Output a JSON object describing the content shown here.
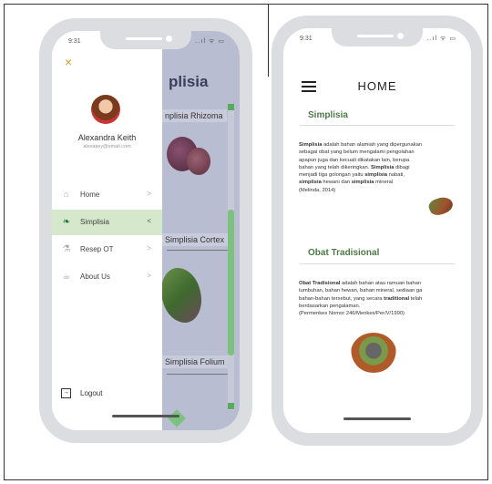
{
  "left_phone": {
    "status_time": "9:31",
    "status_icons": "..ıl ᯤ ▭",
    "background": {
      "title": "plisia",
      "items": [
        "nplisia Rhizoma",
        "Simplisia Cortex",
        "Simplisia Folium"
      ]
    },
    "drawer": {
      "close_glyph": "×",
      "user_name": "Alexandra Keith",
      "user_email": "alexakey@email.com",
      "menu": [
        {
          "icon": "⌂",
          "label": "Home",
          "chevron": ">"
        },
        {
          "icon": "❧",
          "label": "Simplisia",
          "chevron": "<"
        },
        {
          "icon": "⚗",
          "label": "Resep OT",
          "chevron": ">"
        },
        {
          "icon": "☕",
          "label": "About Us",
          "chevron": ">"
        }
      ],
      "logout_label": "Logout",
      "logout_glyph": "→"
    }
  },
  "right_phone": {
    "status_time": "9:31",
    "status_icons": "..ıl ᯤ ▭",
    "title": "HOME",
    "sections": [
      {
        "title": "Simplisia",
        "lines": [
          [
            "b:Simplisia",
            " adalah bahan alamiah yang dipergunakan"
          ],
          [
            "sebagai obat yang belum mengalami pengolahan"
          ],
          [
            "apapun juga dan kecuali dikatakan lain, berupa"
          ],
          [
            "bahan yang telah dikeringkan. ",
            "b:Simplisia",
            " dibagi"
          ],
          [
            "menjadi tiga golongan yaitu ",
            "b:simplisia",
            " nabati,"
          ],
          [
            "b:simplisia",
            " hewani dan ",
            "b:simplisia",
            " mineral"
          ],
          [
            "(Melinda, 2014)"
          ]
        ]
      },
      {
        "title": "Obat Tradisional",
        "lines": [
          [
            "b:Obat Tradisional",
            " adalah bahan atau ramuan bahan"
          ],
          [
            "tumbuhan, bahan hewan, bahan mineral, sediaan ga"
          ],
          [
            "bahan-bahan tersebut, yang secara ",
            "b:traditional",
            " telah"
          ],
          [
            "berdasarkan pengalaman."
          ],
          [
            "(Permenkes Nomor 246/Menkes/Per/V/1990)"
          ]
        ]
      }
    ]
  },
  "colors": {
    "accent_green": "#4e7a4a",
    "active_menu_bg": "#d5e8cc",
    "overlay": "#b9bdd2",
    "close_icon": "#e0a020"
  }
}
